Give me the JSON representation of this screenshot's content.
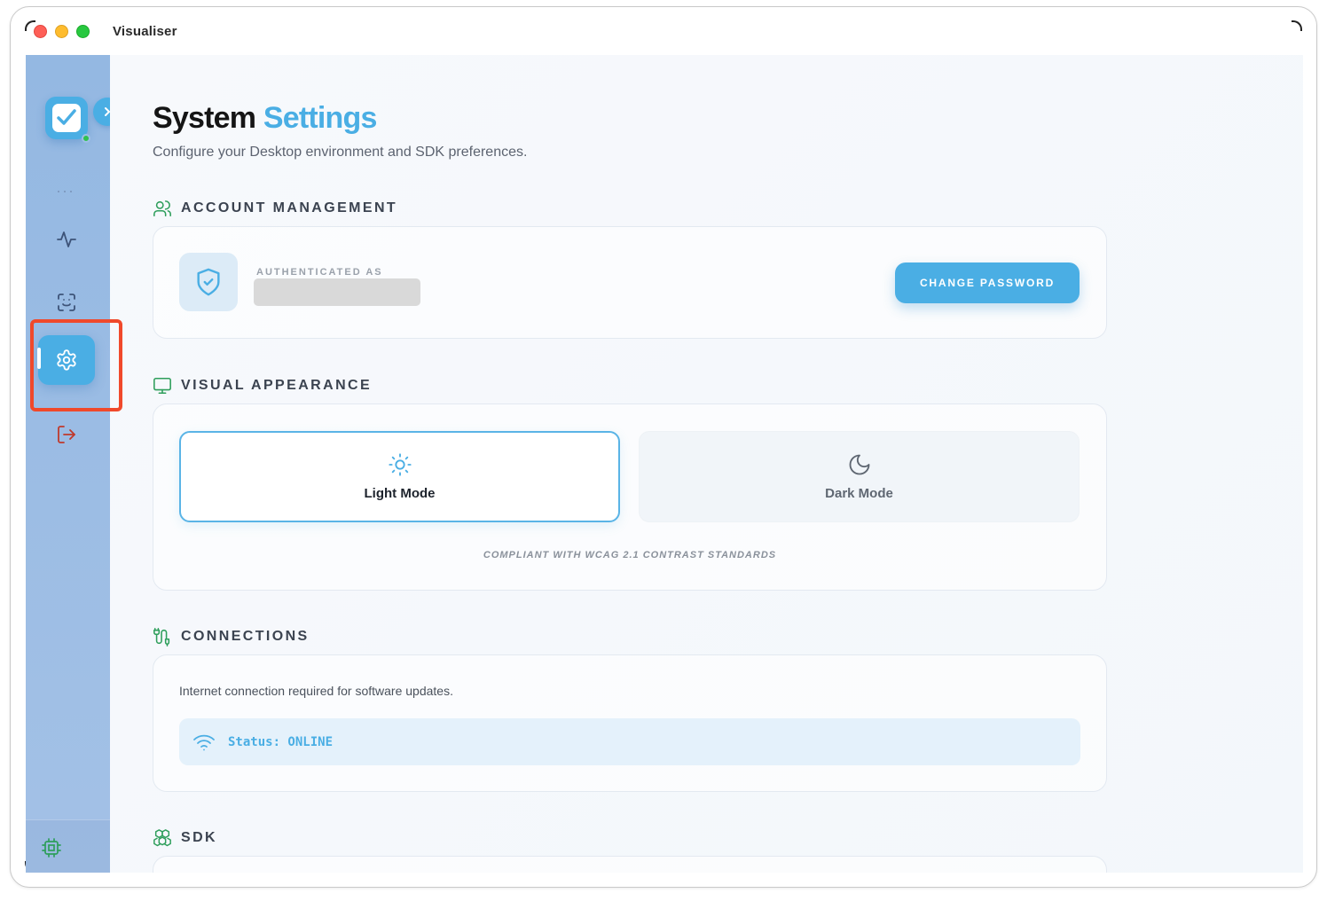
{
  "window": {
    "title": "Visualiser"
  },
  "sidebar": {
    "more": "···",
    "items": [
      {
        "name": "activity",
        "icon": "activity-icon"
      },
      {
        "name": "scan-face",
        "icon": "scan-face-icon"
      },
      {
        "name": "settings",
        "icon": "gear-icon",
        "active": true
      },
      {
        "name": "logout",
        "icon": "logout-icon"
      }
    ],
    "footer_icon": "chip-icon"
  },
  "page": {
    "title_main": "System",
    "title_accent": "Settings",
    "subtitle": "Configure your Desktop environment and SDK preferences."
  },
  "account": {
    "heading": "ACCOUNT MANAGEMENT",
    "auth_label": "AUTHENTICATED AS",
    "change_password": "CHANGE PASSWORD"
  },
  "appearance": {
    "heading": "VISUAL APPEARANCE",
    "light_label": "Light Mode",
    "dark_label": "Dark Mode",
    "selected": "light",
    "note": "COMPLIANT WITH WCAG 2.1 CONTRAST STANDARDS"
  },
  "connections": {
    "heading": "CONNECTIONS",
    "description": "Internet connection required for software updates.",
    "status": "Status: ONLINE"
  },
  "sdk": {
    "heading": "SDK"
  },
  "colors": {
    "accent": "#4aaee4",
    "section_icon": "#2e9e5b",
    "logout": "#c0392b",
    "highlight": "#f0492b"
  }
}
